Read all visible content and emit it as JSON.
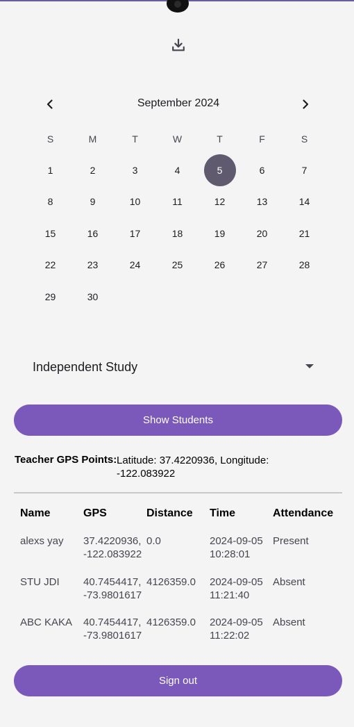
{
  "calendar": {
    "month_title": "September 2024",
    "weekdays": [
      "S",
      "M",
      "T",
      "W",
      "T",
      "F",
      "S"
    ],
    "days": [
      "1",
      "2",
      "3",
      "4",
      "5",
      "6",
      "7",
      "8",
      "9",
      "10",
      "11",
      "12",
      "13",
      "14",
      "15",
      "16",
      "17",
      "18",
      "19",
      "20",
      "21",
      "22",
      "23",
      "24",
      "25",
      "26",
      "27",
      "28",
      "29",
      "30"
    ],
    "selected_day": "5",
    "leading_blanks": 0
  },
  "dropdown": {
    "value": "Independent Study"
  },
  "buttons": {
    "show_students": "Show Students",
    "sign_out": "Sign out"
  },
  "teacher_gps": {
    "label": "Teacher GPS Points:",
    "value_line1": "Latitude: 37.4220936, Longitude:",
    "value_line2": "-122.083922"
  },
  "table": {
    "headers": [
      "Name",
      "GPS",
      "Distance",
      "Time",
      "Attendance"
    ],
    "rows": [
      {
        "name": "alexs yay",
        "gps_lat": "37.4220936,",
        "gps_lon": "-122.083922",
        "distance": "0.0",
        "time_date": "2024-09-05",
        "time_clock": "10:28:01",
        "attendance": "Present"
      },
      {
        "name": "STU JDI",
        "gps_lat": "40.7454417,",
        "gps_lon": "-73.9801617",
        "distance": "4126359.0",
        "time_date": "2024-09-05",
        "time_clock": "11:21:40",
        "attendance": "Absent"
      },
      {
        "name": "ABC KAKA",
        "gps_lat": "40.7454417,",
        "gps_lon": "-73.9801617",
        "distance": "4126359.0",
        "time_date": "2024-09-05",
        "time_clock": "11:22:02",
        "attendance": "Absent"
      }
    ]
  },
  "icons": {
    "download": "download-icon",
    "prev": "chevron-left-icon",
    "next": "chevron-right-icon",
    "dropdown": "caret-down-icon"
  },
  "colors": {
    "accent": "#7a59bb",
    "selected_day": "#605a6e",
    "background": "#f4f4f4"
  }
}
